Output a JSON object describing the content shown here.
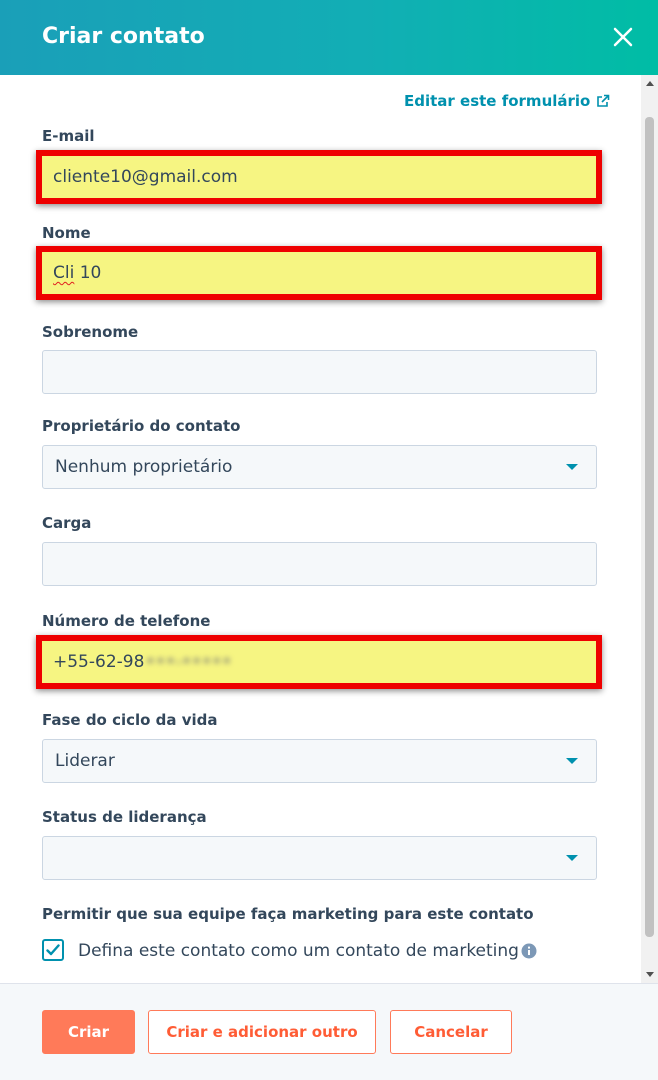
{
  "header": {
    "title": "Criar contato",
    "close_icon": "close-icon",
    "gradient_start": "#1a9fb8",
    "gradient_end": "#00bda5"
  },
  "form": {
    "edit_link": "Editar este formulário",
    "edit_link_icon": "external-link-icon",
    "email": {
      "label": "E-mail",
      "value": "cliente10@gmail.com"
    },
    "first_name": {
      "label": "Nome",
      "value_misspelled": "Cli",
      "value_rest": " 10"
    },
    "last_name": {
      "label": "Sobrenome",
      "value": ""
    },
    "owner": {
      "label": "Proprietário do contato",
      "value": "Nenhum proprietário"
    },
    "job": {
      "label": "Carga",
      "value": ""
    },
    "phone": {
      "label": "Número de telefone",
      "value_visible": "+55-62-98",
      "value_blurred": "•••-•••••"
    },
    "lifecycle": {
      "label": "Fase do ciclo da vida",
      "value": "Liderar"
    },
    "lead_status": {
      "label": "Status de liderança",
      "value": ""
    },
    "marketing": {
      "heading": "Permitir que sua equipe faça marketing para este contato",
      "checkbox_label": "Defina este contato como um contato de marketing",
      "checked": true,
      "info_icon": "info-icon"
    }
  },
  "footer": {
    "create": "Criar",
    "create_add": "Criar e adicionar outro",
    "cancel": "Cancelar"
  },
  "colors": {
    "accent": "#0091ae",
    "primary_button": "#ff7a59",
    "highlight_fill": "#f6f582",
    "highlight_border": "#ee0000"
  }
}
